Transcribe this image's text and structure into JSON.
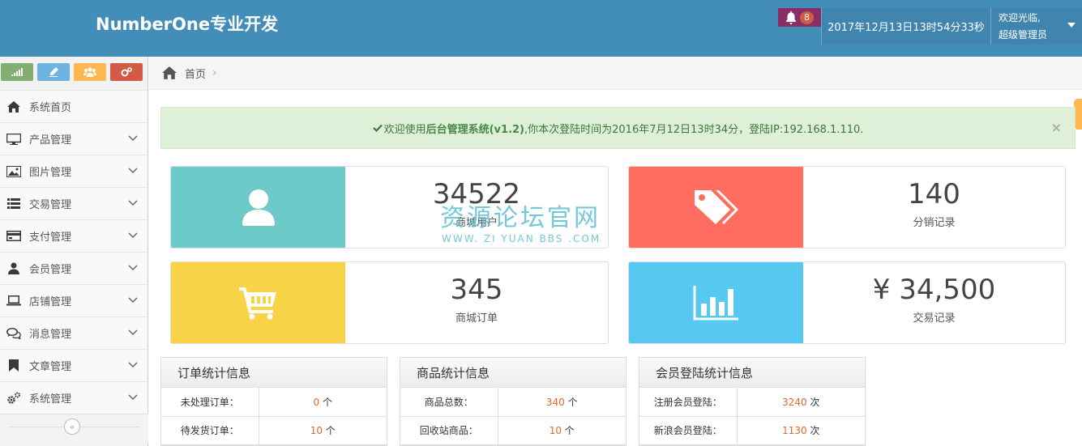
{
  "header": {
    "brand": "NumberOne专业开发",
    "notification_count": "8",
    "datetime": "2017年12月13日13时54分33秒",
    "welcome": "欢迎光临,",
    "username": "超级管理员"
  },
  "sidebar": {
    "items": [
      {
        "label": "系统首页",
        "icon": "home-icon"
      },
      {
        "label": "产品管理",
        "icon": "desktop-icon"
      },
      {
        "label": "图片管理",
        "icon": "picture-icon"
      },
      {
        "label": "交易管理",
        "icon": "list-icon"
      },
      {
        "label": "支付管理",
        "icon": "credit-card-icon"
      },
      {
        "label": "会员管理",
        "icon": "user-icon"
      },
      {
        "label": "店铺管理",
        "icon": "laptop-icon"
      },
      {
        "label": "消息管理",
        "icon": "comments-icon"
      },
      {
        "label": "文章管理",
        "icon": "bookmark-icon"
      },
      {
        "label": "系统管理",
        "icon": "cogs-icon"
      }
    ],
    "collapse_label": "«"
  },
  "breadcrumb": {
    "home": "首页",
    "separator": "›"
  },
  "alert": {
    "prefix": "欢迎使用",
    "system_name": "后台管理系统(v1.2)",
    "suffix": ",你本次登陆时间为2016年7月12日13时34分，登陆IP:192.168.1.110.",
    "close": "×"
  },
  "cards": [
    {
      "value": "34522",
      "label": "商城用户",
      "color": "#6ccac9"
    },
    {
      "value": "140",
      "label": "分销记录",
      "color": "#ff6c60"
    },
    {
      "value": "345",
      "label": "商城订单",
      "color": "#f8d347"
    },
    {
      "value": "¥ 34,500",
      "label": "交易记录",
      "color": "#57c8f2"
    }
  ],
  "watermark": {
    "title": "资源论坛官网",
    "url": "WWW. ZI YUAN BBS .COM"
  },
  "panels": [
    {
      "title": "订单统计信息",
      "rows": [
        {
          "key": "未处理订单：",
          "value": "0",
          "unit": "个"
        },
        {
          "key": "待发货订单：",
          "value": "10",
          "unit": "个"
        }
      ]
    },
    {
      "title": "商品统计信息",
      "rows": [
        {
          "key": "商品总数：",
          "value": "340",
          "unit": "个"
        },
        {
          "key": "回收站商品：",
          "value": "10",
          "unit": "个"
        }
      ]
    },
    {
      "title": "会员登陆统计信息",
      "rows": [
        {
          "key": "注册会员登陆：",
          "value": "3240",
          "unit": "次"
        },
        {
          "key": "新浪会员登陆：",
          "value": "1130",
          "unit": "次"
        }
      ]
    }
  ]
}
